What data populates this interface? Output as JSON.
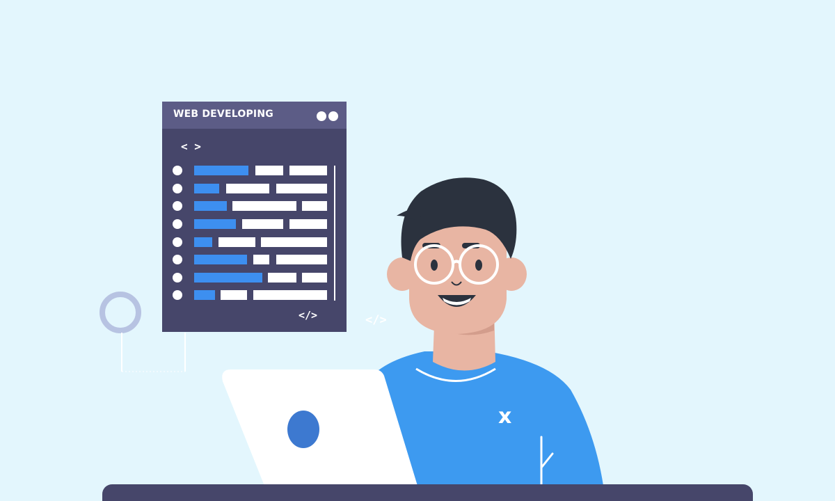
{
  "code_window": {
    "title": "WEB DEVELOPING",
    "open_tag": "< >",
    "close_tag": "</>",
    "colors": {
      "body": "#46466a",
      "header": "#5c5c86",
      "accent": "#3d8ff0",
      "line": "#ffffff"
    }
  },
  "floating_tag": "</>",
  "shirt_mark": "x",
  "colors": {
    "background": "#e3f6fd",
    "shirt": "#3d9af0",
    "skin": "#e8b5a3",
    "hair": "#2b323e",
    "laptop": "#ffffff",
    "laptop_logo": "#3d79d0",
    "desk": "#46466a",
    "ring": "#b7c3e2"
  }
}
